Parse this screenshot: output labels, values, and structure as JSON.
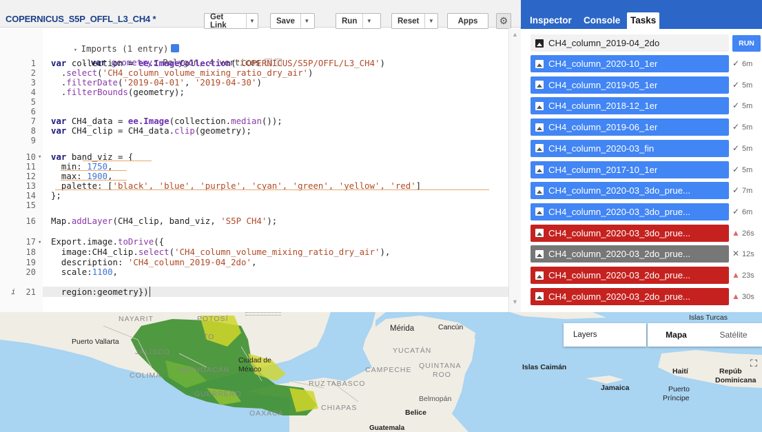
{
  "editor": {
    "title": "COPERNICUS_S5P_OFFL_L3_CH4 *",
    "buttons": {
      "get_link": "Get Link",
      "save": "Save",
      "run": "Run",
      "reset": "Reset",
      "apps": "Apps"
    },
    "imports": {
      "header": "Imports (1 entry)",
      "geometry_kw": "var",
      "geometry_name": "geometry",
      "geometry_desc": ": Polygon, 4 vertices"
    },
    "line_numbers": [
      "1",
      "2",
      "3",
      "4",
      "5",
      "6",
      "7",
      "8",
      "9",
      "10",
      "11",
      "12",
      "13",
      "14",
      "15",
      "16",
      "17",
      "18",
      "19",
      "20",
      "21"
    ],
    "code": {
      "l1_kw": "var",
      "l1_a": " collection = ",
      "l1_fn": "ee.ImageCollection",
      "l1_b": "(",
      "l1_str": "'COPERNICUS/S5P/OFFL/L3_CH4'",
      "l1_c": ")",
      "l2_a": "  .",
      "l2_m": "select",
      "l2_b": "(",
      "l2_str": "'CH4_column_volume_mixing_ratio_dry_air'",
      "l2_c": ")",
      "l3_a": "  .",
      "l3_m": "filterDate",
      "l3_b": "(",
      "l3_s1": "'2019-04-01'",
      "l3_c": ", ",
      "l3_s2": "'2019-04-30'",
      "l3_d": ")",
      "l4_a": "  .",
      "l4_m": "filterBounds",
      "l4_b": "(geometry);",
      "l6_kw": "var",
      "l6_a": " CH4_data = ",
      "l6_fn": "ee.Image",
      "l6_b": "(collection.",
      "l6_m": "median",
      "l6_c": "());",
      "l7_kw": "var",
      "l7_a": " CH4_clip = CH4_data.",
      "l7_m": "clip",
      "l7_b": "(geometry);",
      "l9_kw": "var",
      "l9_a": " band_viz = {",
      "l10_a": "  min: ",
      "l10_n": "1750",
      "l10_b": ",",
      "l11_a": "  max: ",
      "l11_n": "1900",
      "l11_b": ",",
      "l12_a": "  palette: [",
      "l12_s": "'black', 'blue', 'purple', 'cyan', 'green', 'yellow', 'red'",
      "l12_b": "]",
      "l13_a": "};",
      "l15_a": "Map.",
      "l15_m": "addLayer",
      "l15_b": "(CH4_clip, band_viz, ",
      "l15_s": "'S5P CH4'",
      "l15_c": ");",
      "l17_a": "Export.image.",
      "l17_m": "toDrive",
      "l17_b": "({",
      "l18_a": "  image:CH4_clip.",
      "l18_m": "select",
      "l18_b": "(",
      "l18_s": "'CH4_column_volume_mixing_ratio_dry_air'",
      "l18_c": "),",
      "l19_a": "  description: ",
      "l19_s": "'CH4_column_2019-04_2do'",
      "l19_b": ",",
      "l20_a": "  scale:",
      "l20_n": "1100",
      "l20_b": ",",
      "l21_a": "  region:geometry})"
    },
    "info_marker": "i"
  },
  "panel": {
    "tabs": [
      "Inspector",
      "Console",
      "Tasks"
    ],
    "run_label": "RUN",
    "tasks": [
      {
        "name": "CH4_column_2019-04_2do",
        "state": "pending",
        "time": ""
      },
      {
        "name": "CH4_column_2020-10_1er",
        "state": "done",
        "time": "6m"
      },
      {
        "name": "CH4_column_2019-05_1er",
        "state": "done",
        "time": "5m"
      },
      {
        "name": "CH4_column_2018-12_1er",
        "state": "done",
        "time": "5m"
      },
      {
        "name": "CH4_column_2019-06_1er",
        "state": "done",
        "time": "5m"
      },
      {
        "name": "CH4_column_2020-03_fin",
        "state": "done",
        "time": "5m"
      },
      {
        "name": "CH4_column_2017-10_1er",
        "state": "done",
        "time": "5m"
      },
      {
        "name": "CH4_column_2020-03_3do_prue...",
        "state": "done",
        "time": "7m"
      },
      {
        "name": "CH4_column_2020-03_3do_prue...",
        "state": "done",
        "time": "6m"
      },
      {
        "name": "CH4_column_2020-03_3do_prue...",
        "state": "failed",
        "time": "26s"
      },
      {
        "name": "CH4_column_2020-03_2do_prue...",
        "state": "cancelled",
        "time": "12s"
      },
      {
        "name": "CH4_column_2020-03_2do_prue...",
        "state": "failed",
        "time": "23s"
      },
      {
        "name": "CH4_column_2020-03_2do_prue...",
        "state": "failed",
        "time": "30s"
      }
    ]
  },
  "map": {
    "layers_label": "Layers",
    "map_types": [
      "Mapa",
      "Satélite"
    ],
    "labels": {
      "nayarit": "NAYARIT",
      "potosi": "POTOSÍ",
      "puerto_vallarta": "Puerto Vallarta",
      "jalisco": "JALISCO",
      "colima": "COLIMA",
      "michoacan": "MICHOACÁN",
      "mexico": "México",
      "ciudad_de": "Ciudad de",
      "guerrero": "GUERRERO",
      "oaxaca": "OAXACA",
      "merida": "Mérida",
      "cancun": "Cancún",
      "yucatan": "YUCATÁN",
      "campeche": "CAMPECHE",
      "quintana": "QUINTANA",
      "roo": "ROO",
      "tabasco": "TABASCO",
      "chiapas": "CHIAPAS",
      "belmopan": "Belmopán",
      "belice": "Belice",
      "guatemala": "Guatemala",
      "islas_caiman": "Islas Caimán",
      "islas_turcas": "Islas Turcas",
      "haiti": "Haití",
      "jamaica": "Jamaica",
      "puerto": "Puerto",
      "principe": "Príncipe",
      "republica": "Repúb",
      "dominicana": "Dominicana",
      "to": "TO",
      "ruz": "RUZ"
    },
    "colors": {
      "sea": "#a9d4f2",
      "land": "#f0ede5",
      "overlay_green": "#3d8f2e",
      "overlay_yellow": "#cfd62a"
    }
  }
}
